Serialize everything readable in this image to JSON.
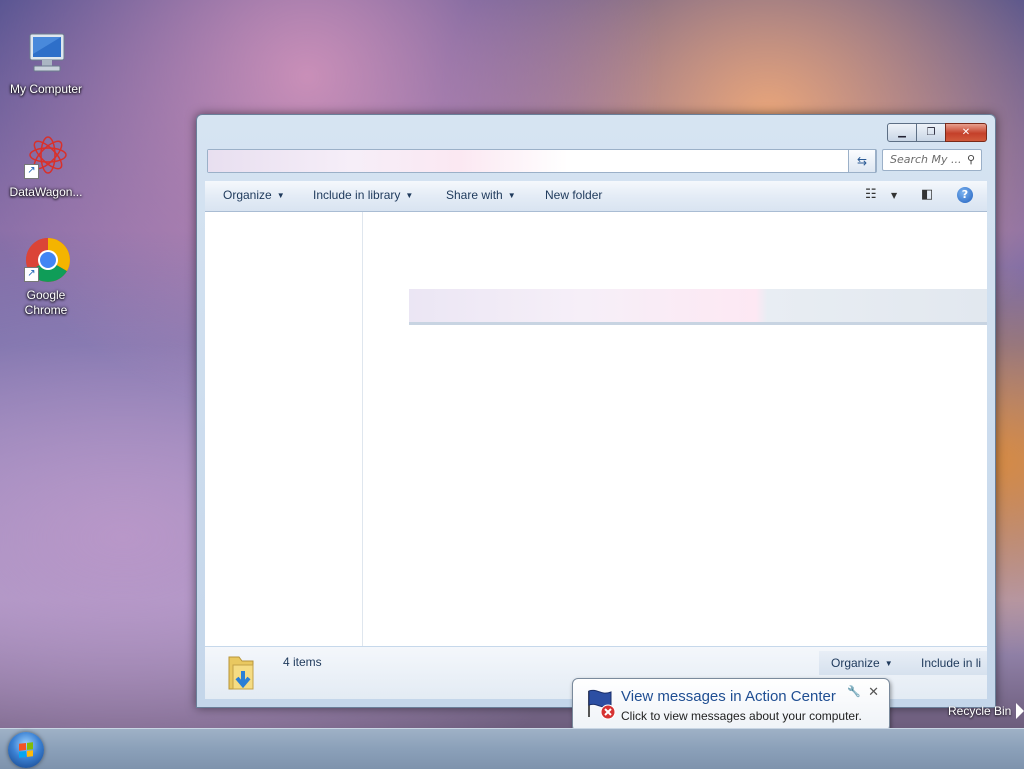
{
  "desktop": {
    "icons": [
      {
        "label": "My Computer",
        "icon": "computer-icon"
      },
      {
        "label": "DataWagon...",
        "icon": "datawagon-icon"
      },
      {
        "label": "Google Chrome",
        "icon": "chrome-icon"
      }
    ],
    "recycle_bin_label": "Recycle Bin"
  },
  "window": {
    "search_placeholder": "Search My ...",
    "toolbar": {
      "organize": "Organize",
      "include_in_library": "Include in library",
      "share_with": "Share with",
      "new_folder": "New folder"
    },
    "details": {
      "items_count": "4 items",
      "organize": "Organize",
      "include_in_library": "Include in li"
    }
  },
  "notification": {
    "title": "View messages in Action Center",
    "text": "Click to view messages about your computer.",
    "icon": "action-center-flag-icon"
  },
  "taskbar": {
    "start_icon": "windows-start-orb"
  },
  "colors": {
    "window_frame": "#c4d6ea",
    "toolbar_text": "#1e395b",
    "notification_title": "#1f4e92",
    "close_button": "#c4402a",
    "taskbar": "#8ba0b9"
  }
}
